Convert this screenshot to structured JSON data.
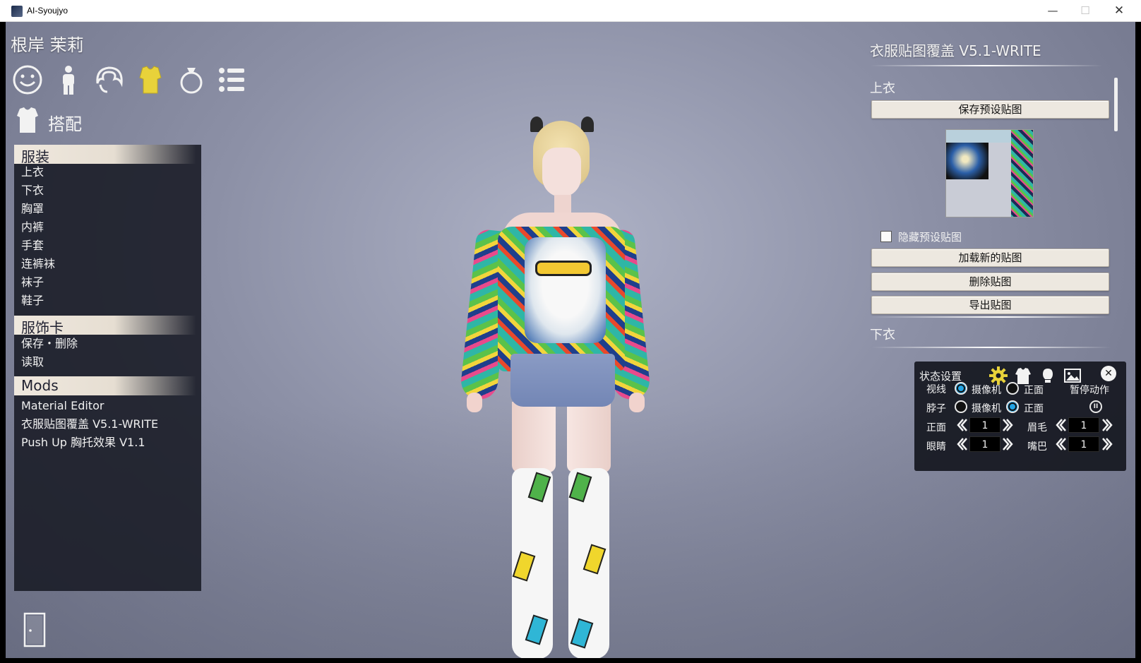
{
  "window": {
    "title": "AI-Syoujyo",
    "minimize": "—",
    "maximize": "☐",
    "close": "✕"
  },
  "character_name": "根岸 茉莉",
  "category_icons": [
    "face-icon",
    "body-icon",
    "hair-icon",
    "clothes-icon",
    "accessory-icon",
    "list-icon"
  ],
  "section": {
    "title": "搭配"
  },
  "left_panel": {
    "clothing_header": "服装",
    "clothing_items": [
      "上衣",
      "下衣",
      "胸罩",
      "内裤",
      "手套",
      "连裤袜",
      "袜子",
      "鞋子"
    ],
    "card_header": "服饰卡",
    "card_items": [
      "保存・删除",
      "读取"
    ],
    "mods_header": "Mods",
    "mods_items": [
      "Material Editor",
      "衣服贴图覆盖 V5.1-WRITE",
      "Push Up 胸托效果 V1.1"
    ]
  },
  "right_panel": {
    "title": "衣服贴图覆盖 V5.1-WRITE",
    "top_section": "上衣",
    "save_preset_button": "保存预设贴图",
    "hide_preset_label": "隐藏预设贴图",
    "hide_preset_checked": false,
    "load_button": "加载新的贴图",
    "delete_button": "删除贴图",
    "export_button": "导出贴图",
    "bottom_section": "下衣"
  },
  "state_panel": {
    "title": "状态设置",
    "icons": [
      "gear-icon",
      "clothes-icon",
      "light-icon",
      "image-icon"
    ],
    "gaze_label": "视线",
    "neck_label": "脖子",
    "camera_label": "摄像机",
    "front_label": "正面",
    "gaze_selected": "摄像机",
    "neck_selected": "正面",
    "pause_label": "暂停动作",
    "pause_symbol": "II",
    "front_value_label": "正面",
    "front_value": "1",
    "eyebrow_label": "眉毛",
    "eyebrow_value": "1",
    "eyes_label": "眼睛",
    "eyes_value": "1",
    "mouth_label": "嘴巴",
    "mouth_value": "1",
    "close": "✕"
  },
  "colors": {
    "accent_yellow": "#e8d23a",
    "radio_blue": "#23a4e4",
    "panel_dark": "#181a24",
    "button_bg": "#ede8e0"
  }
}
